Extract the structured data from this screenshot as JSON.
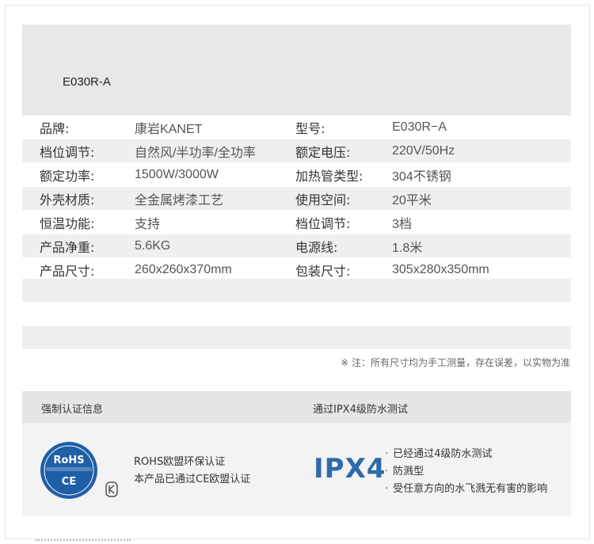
{
  "model_title": "E030R-A",
  "specs": [
    {
      "k1": "品牌:",
      "v1": "康岩KANET",
      "k2": "型号:",
      "v2": "E030R−A"
    },
    {
      "k1": "档位调节:",
      "v1": "自然风/半功率/全功率",
      "k2": "额定电压:",
      "v2": "220V/50Hz"
    },
    {
      "k1": "额定功率:",
      "v1": "1500W/3000W",
      "k2": "加热管类型:",
      "v2": "304不锈钢"
    },
    {
      "k1": "外壳材质:",
      "v1": "全金属烤漆工艺",
      "k2": "使用空间:",
      "v2": "20平米"
    },
    {
      "k1": "恒温功能:",
      "v1": "支持",
      "k2": "档位调节:",
      "v2": "3档"
    },
    {
      "k1": "产品净重:",
      "v1": "5.6KG",
      "k2": "电源线:",
      "v2": "1.8米"
    },
    {
      "k1": "产品尺寸:",
      "v1": "260x260x370mm",
      "k2": "包装尺寸:",
      "v2": "305x280x350mm"
    }
  ],
  "note": "※ 注：所有尺寸均为手工测量，存在误差，以实物为准",
  "cert": {
    "left_title": "强制认证信息",
    "right_title": "通过IPX4级防水测试",
    "rohs_label": "RoHS",
    "ce_label": "CE",
    "rohs_lines": [
      "ROHS欧盟环保认证",
      "本产品已通过CE欧盟认证"
    ],
    "ipx_label": "IPX4",
    "ipx_lines": [
      "已经通过4级防水测试",
      "防溅型",
      "受任意方向的水飞溅无有害的影响"
    ]
  },
  "colors": {
    "badge_blue": "#1f5fa8",
    "ipx_blue": "#2e6aa8",
    "header_gray": "#e8e8e8"
  }
}
